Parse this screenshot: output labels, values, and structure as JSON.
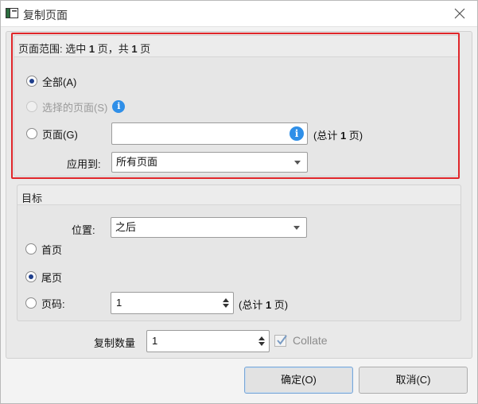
{
  "window": {
    "title": "复制页面",
    "icon": "window-icon",
    "close_icon": "close-icon"
  },
  "page_range": {
    "header_prefix": "页面范围: 选中 ",
    "header_selected": "1",
    "header_mid": " 页，共 ",
    "header_total": "1",
    "header_suffix": " 页",
    "options": [
      {
        "label": "全部(A)",
        "checked": true,
        "disabled": false
      },
      {
        "label": "选择的页面(S)",
        "checked": false,
        "disabled": true
      },
      {
        "label": "页面(G)",
        "checked": false,
        "disabled": false
      }
    ],
    "pages_input_value": "",
    "pages_total_prefix": "(总计 ",
    "pages_total_count": "1",
    "pages_total_suffix": " 页)",
    "apply_to_label": "应用到:",
    "apply_to_value": "所有页面",
    "highlight_color": "#e0262a"
  },
  "target": {
    "header": "目标",
    "position_label": "位置:",
    "position_value": "之后",
    "options": [
      {
        "label": "首页",
        "checked": false
      },
      {
        "label": "尾页",
        "checked": true
      },
      {
        "label": "页码:",
        "checked": false
      }
    ],
    "page_number_value": "1",
    "page_total_prefix": "(总计 ",
    "page_total_count": "1",
    "page_total_suffix": " 页)"
  },
  "copies": {
    "label": "复制数量",
    "value": "1",
    "collate_label": "Collate",
    "collate_checked": true
  },
  "buttons": {
    "ok": "确定(O)",
    "cancel": "取消(C)"
  },
  "colors": {
    "info": "#2f8fe8",
    "radio_dot": "#1f3f8c"
  }
}
